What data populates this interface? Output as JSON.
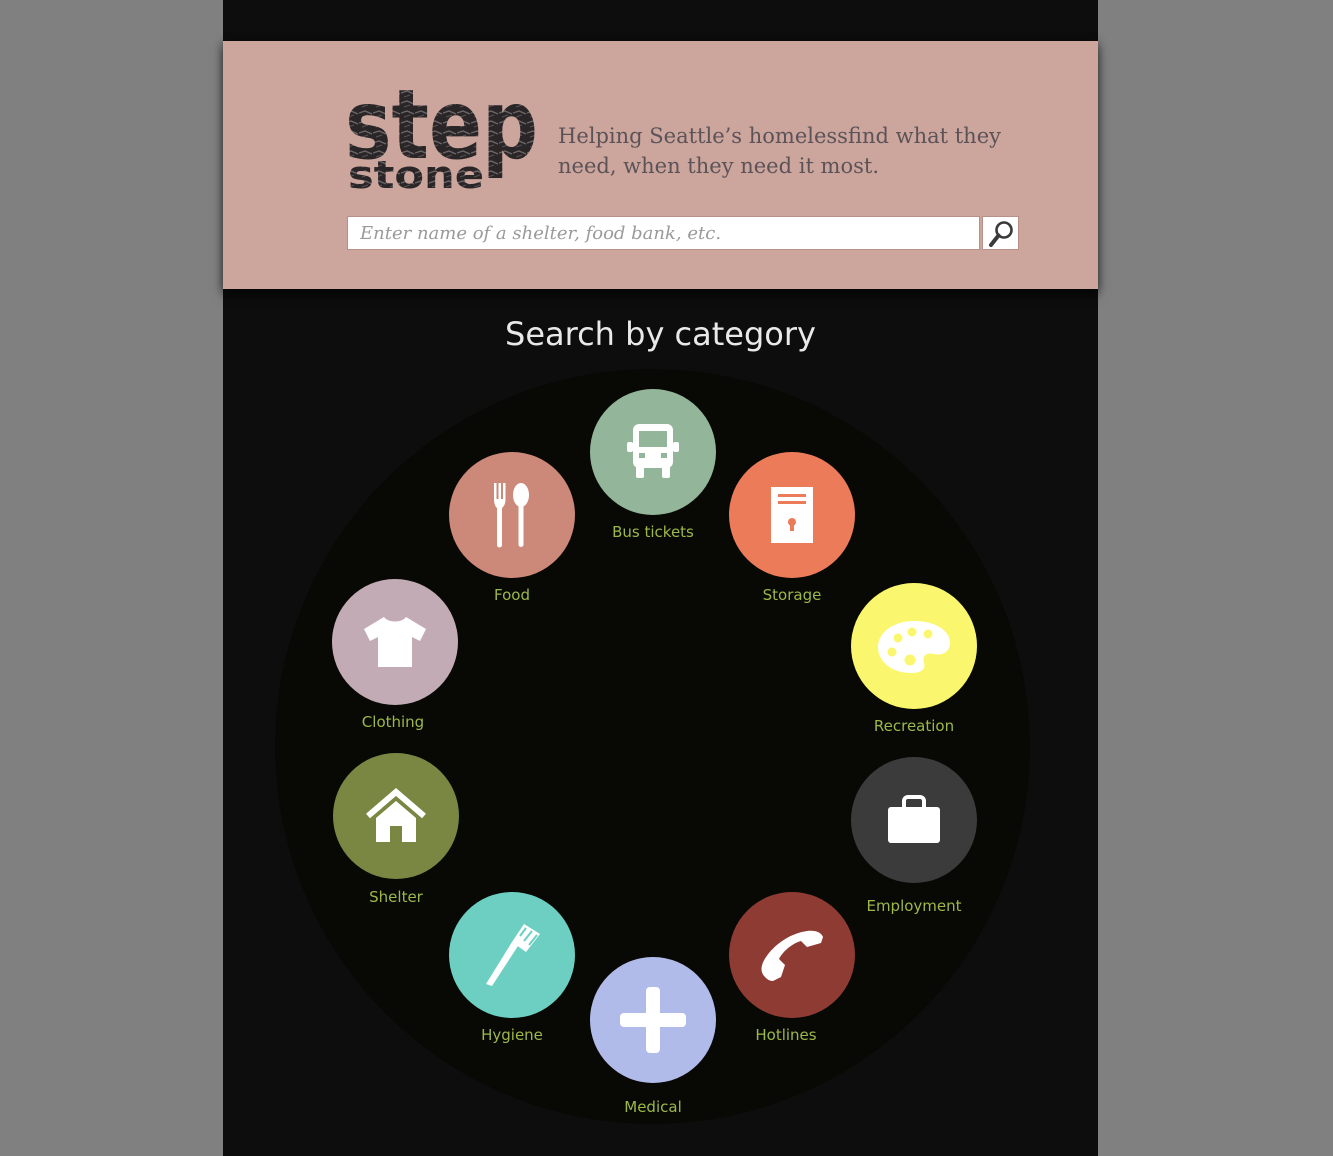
{
  "header": {
    "logo_alt": "step stone",
    "tagline": "Helping Seattle’s homelessfind what they need, when they need it most.",
    "search": {
      "placeholder": "Enter name of a shelter, food bank, etc.",
      "value": ""
    },
    "search_button_icon": "magnifier-icon"
  },
  "main": {
    "title": "Search by category",
    "categories": [
      {
        "label": "Bus tickets",
        "icon": "bus-icon",
        "color": "#93b59a"
      },
      {
        "label": "Storage",
        "icon": "locker-icon",
        "color": "#ec7b59"
      },
      {
        "label": "Recreation",
        "icon": "palette-icon",
        "color": "#faf76e"
      },
      {
        "label": "Employment",
        "icon": "briefcase-icon",
        "color": "#3b3b3b"
      },
      {
        "label": "Hotlines",
        "icon": "phone-icon",
        "color": "#8e3b34"
      },
      {
        "label": "Medical",
        "icon": "plus-icon",
        "color": "#b1bbe9"
      },
      {
        "label": "Hygiene",
        "icon": "toothbrush-icon",
        "color": "#6ccfc1"
      },
      {
        "label": "Shelter",
        "icon": "house-icon",
        "color": "#7a8743"
      },
      {
        "label": "Clothing",
        "icon": "shirt-icon",
        "color": "#c2abb4"
      },
      {
        "label": "Food",
        "icon": "fork-spoon-icon",
        "color": "#cc8878"
      }
    ],
    "label_color": "#9cb84a"
  },
  "colors": {
    "header_bg": "#cca59d",
    "page_bg": "#0d0d0d",
    "outer_bg": "#808080"
  }
}
